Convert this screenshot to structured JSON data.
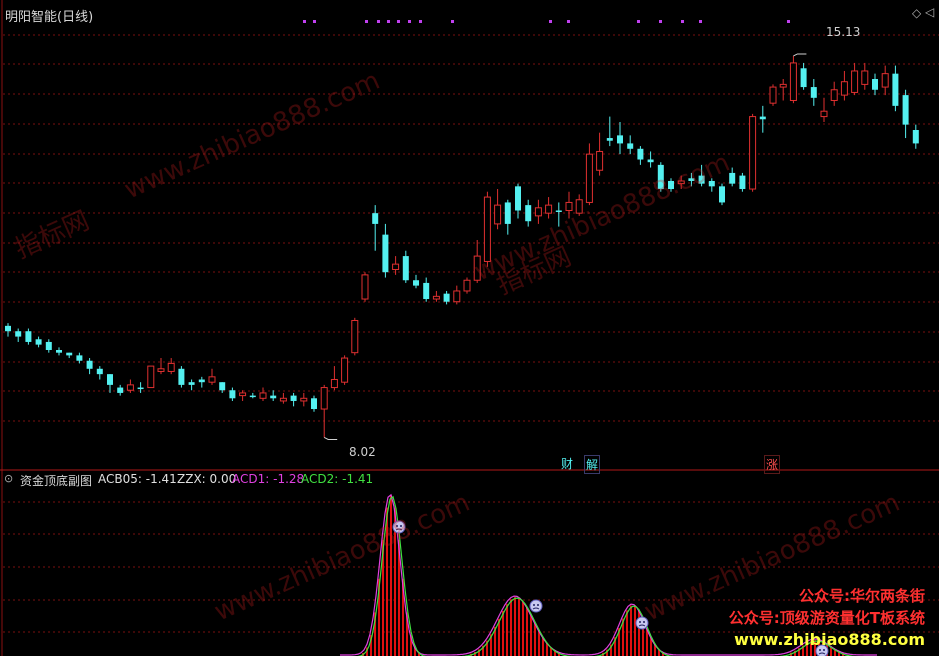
{
  "main_panel": {
    "title": "明阳智能(日线)",
    "high_label": "15.13",
    "low_label": "8.02",
    "event_tags": [
      "财",
      "解",
      "涨"
    ]
  },
  "sub_panel": {
    "title": "资金顶底副图",
    "indicators": [
      {
        "label": "ACB05: -1.41",
        "color": "#e0e0e0"
      },
      {
        "label": "ZZX: 0.00",
        "color": "#e0e0e0"
      },
      {
        "label": "ACD1: -1.28",
        "color": "#e040e0"
      },
      {
        "label": "ACD2: -1.41",
        "color": "#40e040"
      }
    ]
  },
  "watermark": {
    "site": "www.zhibiao888.com",
    "cn": "指标网"
  },
  "promo": {
    "line1": "公众号:华尔两条街",
    "line2": "公众号:顶级游资量化T板系统",
    "line3": "www.zhibiao888.com"
  },
  "colors": {
    "up": "#e03030",
    "down": "#54f0f0",
    "grid": "#7a1010",
    "acd1": "#e040e0",
    "acd2": "#40e040",
    "bar": "#e01010",
    "dots": "#c040f0"
  },
  "chart_data": {
    "type": "candlestick",
    "y_range": [
      7.6,
      15.8
    ],
    "candles": [
      [
        0,
        10.0,
        10.1,
        10.15,
        9.9
      ],
      [
        0,
        9.9,
        10.0,
        10.05,
        9.8
      ],
      [
        0,
        9.8,
        10.0,
        10.05,
        9.75
      ],
      [
        0,
        9.75,
        9.85,
        9.9,
        9.7
      ],
      [
        0,
        9.65,
        9.8,
        9.85,
        9.6
      ],
      [
        0,
        9.6,
        9.65,
        9.7,
        9.55
      ],
      [
        0,
        9.6,
        9.55,
        9.6,
        9.5
      ],
      [
        0,
        9.55,
        9.45,
        9.6,
        9.4
      ],
      [
        0,
        9.45,
        9.3,
        9.5,
        9.2
      ],
      [
        0,
        9.3,
        9.2,
        9.35,
        9.1
      ],
      [
        0,
        9.2,
        9.0,
        9.2,
        8.85
      ],
      [
        0,
        8.95,
        8.85,
        9.0,
        8.8
      ],
      [
        1,
        8.9,
        9.0,
        9.1,
        8.85
      ],
      [
        0,
        8.95,
        8.95,
        9.05,
        8.85
      ],
      [
        1,
        8.95,
        9.35,
        9.35,
        8.95
      ],
      [
        1,
        9.25,
        9.3,
        9.5,
        9.2
      ],
      [
        1,
        9.25,
        9.4,
        9.5,
        9.2
      ],
      [
        0,
        9.3,
        9.0,
        9.35,
        8.95
      ],
      [
        0,
        9.05,
        9.0,
        9.1,
        8.9
      ],
      [
        0,
        9.05,
        9.1,
        9.15,
        8.95
      ],
      [
        1,
        9.05,
        9.15,
        9.3,
        9.0
      ],
      [
        0,
        9.05,
        8.9,
        9.05,
        8.85
      ],
      [
        0,
        8.9,
        8.75,
        8.95,
        8.7
      ],
      [
        1,
        8.8,
        8.85,
        8.9,
        8.7
      ],
      [
        0,
        8.8,
        8.8,
        8.85,
        8.75
      ],
      [
        1,
        8.75,
        8.85,
        8.95,
        8.7
      ],
      [
        0,
        8.8,
        8.75,
        8.9,
        8.7
      ],
      [
        1,
        8.7,
        8.75,
        8.85,
        8.65
      ],
      [
        0,
        8.8,
        8.7,
        8.85,
        8.6
      ],
      [
        1,
        8.7,
        8.75,
        8.85,
        8.6
      ],
      [
        0,
        8.75,
        8.55,
        8.8,
        8.5
      ],
      [
        1,
        8.55,
        8.95,
        9.0,
        8.02
      ],
      [
        1,
        8.95,
        9.1,
        9.35,
        8.9
      ],
      [
        1,
        9.05,
        9.5,
        9.55,
        9.0
      ],
      [
        1,
        9.6,
        10.2,
        10.25,
        9.55
      ],
      [
        1,
        10.6,
        11.05,
        11.1,
        10.55
      ],
      [
        0,
        12.2,
        12.0,
        12.35,
        11.5
      ],
      [
        0,
        11.8,
        11.1,
        12.0,
        11.0
      ],
      [
        1,
        11.15,
        11.25,
        11.4,
        11.05
      ],
      [
        0,
        11.4,
        10.95,
        11.5,
        10.9
      ],
      [
        0,
        10.95,
        10.85,
        11.05,
        10.8
      ],
      [
        0,
        10.9,
        10.6,
        11.0,
        10.55
      ],
      [
        1,
        10.6,
        10.65,
        10.75,
        10.55
      ],
      [
        0,
        10.7,
        10.55,
        10.75,
        10.5
      ],
      [
        1,
        10.55,
        10.75,
        10.85,
        10.5
      ],
      [
        1,
        10.75,
        10.95,
        11.0,
        10.7
      ],
      [
        1,
        10.95,
        11.4,
        11.7,
        10.9
      ],
      [
        1,
        11.3,
        12.5,
        12.6,
        11.2
      ],
      [
        1,
        12.0,
        12.35,
        12.65,
        11.9
      ],
      [
        0,
        12.4,
        12.0,
        12.45,
        11.8
      ],
      [
        0,
        12.7,
        12.25,
        12.75,
        12.1
      ],
      [
        0,
        12.35,
        12.05,
        12.45,
        11.95
      ],
      [
        1,
        12.15,
        12.3,
        12.45,
        12.0
      ],
      [
        1,
        12.2,
        12.35,
        12.5,
        12.1
      ],
      [
        0,
        12.25,
        12.25,
        12.4,
        11.95
      ],
      [
        1,
        12.25,
        12.4,
        12.6,
        12.1
      ],
      [
        1,
        12.2,
        12.45,
        12.55,
        12.15
      ],
      [
        1,
        12.4,
        13.3,
        13.5,
        12.35
      ],
      [
        1,
        13.0,
        13.35,
        13.7,
        12.9
      ],
      [
        0,
        13.6,
        13.55,
        14.0,
        13.45
      ],
      [
        0,
        13.65,
        13.5,
        13.9,
        13.3
      ],
      [
        0,
        13.5,
        13.4,
        13.65,
        13.3
      ],
      [
        0,
        13.4,
        13.2,
        13.45,
        13.1
      ],
      [
        0,
        13.2,
        13.15,
        13.35,
        13.05
      ],
      [
        0,
        13.1,
        12.65,
        13.15,
        12.6
      ],
      [
        0,
        12.8,
        12.65,
        12.85,
        12.6
      ],
      [
        1,
        12.75,
        12.8,
        12.9,
        12.65
      ],
      [
        0,
        12.85,
        12.8,
        12.95,
        12.7
      ],
      [
        0,
        12.9,
        12.75,
        13.1,
        12.7
      ],
      [
        0,
        12.8,
        12.7,
        12.85,
        12.6
      ],
      [
        0,
        12.7,
        12.4,
        12.75,
        12.35
      ],
      [
        0,
        12.95,
        12.75,
        13.05,
        12.7
      ],
      [
        0,
        12.9,
        12.65,
        12.95,
        12.6
      ],
      [
        1,
        12.65,
        14.0,
        14.05,
        12.6
      ],
      [
        0,
        14.0,
        13.95,
        14.2,
        13.7
      ],
      [
        1,
        14.25,
        14.55,
        14.6,
        14.2
      ],
      [
        1,
        14.55,
        14.6,
        14.7,
        14.3
      ],
      [
        1,
        14.3,
        15.0,
        15.13,
        14.25
      ],
      [
        0,
        14.9,
        14.55,
        15.0,
        14.5
      ],
      [
        0,
        14.55,
        14.35,
        14.7,
        14.2
      ],
      [
        1,
        14.0,
        14.1,
        14.35,
        13.9
      ],
      [
        1,
        14.3,
        14.5,
        14.65,
        14.2
      ],
      [
        1,
        14.4,
        14.65,
        14.85,
        14.3
      ],
      [
        1,
        14.45,
        14.85,
        15.0,
        14.4
      ],
      [
        1,
        14.6,
        14.85,
        15.0,
        14.5
      ],
      [
        0,
        14.7,
        14.5,
        14.8,
        14.4
      ],
      [
        1,
        14.55,
        14.8,
        14.95,
        14.4
      ],
      [
        0,
        14.8,
        14.2,
        14.95,
        14.1
      ],
      [
        0,
        14.4,
        13.85,
        14.5,
        13.6
      ],
      [
        0,
        13.75,
        13.5,
        13.85,
        13.4
      ]
    ],
    "signal_dot_bars": [
      43,
      44,
      52,
      54,
      56,
      57,
      58,
      59,
      61,
      65,
      69,
      78,
      80,
      95,
      97,
      99,
      111
    ],
    "sub_panel": {
      "series": [
        "ACB05",
        "ACD1",
        "ACD2"
      ],
      "peaks_note": "red bars peak near bars 33, 43-48, 54-56, 72-74"
    }
  }
}
